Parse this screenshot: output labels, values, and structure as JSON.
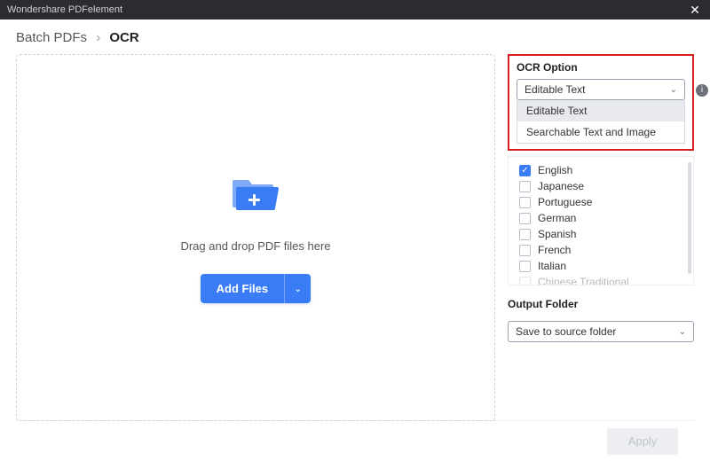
{
  "window": {
    "title": "Wondershare PDFelement",
    "close_glyph": "✕"
  },
  "breadcrumb": {
    "root": "Batch PDFs",
    "sep": "›",
    "current": "OCR"
  },
  "dropzone": {
    "text": "Drag and drop PDF files here",
    "add_label": "Add Files",
    "caret_glyph": "⌄"
  },
  "ocr_option": {
    "label": "OCR Option",
    "selected": "Editable Text",
    "options": [
      "Editable Text",
      "Searchable Text and Image"
    ],
    "info_glyph": "i"
  },
  "languages": [
    {
      "label": "English",
      "checked": true
    },
    {
      "label": "Japanese",
      "checked": false
    },
    {
      "label": "Portuguese",
      "checked": false
    },
    {
      "label": "German",
      "checked": false
    },
    {
      "label": "Spanish",
      "checked": false
    },
    {
      "label": "French",
      "checked": false
    },
    {
      "label": "Italian",
      "checked": false
    },
    {
      "label": "Chinese Traditional",
      "checked": false
    }
  ],
  "output": {
    "label": "Output Folder",
    "selected": "Save to source folder"
  },
  "footer": {
    "apply": "Apply"
  }
}
